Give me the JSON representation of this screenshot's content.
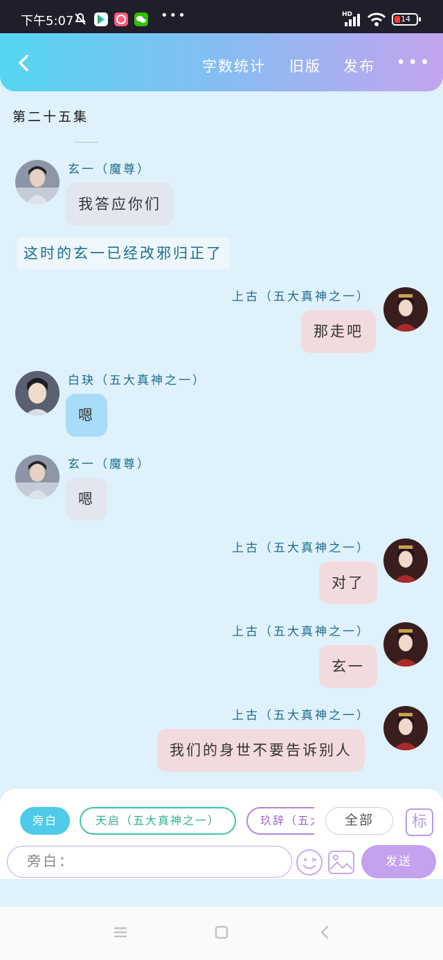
{
  "status_bar": {
    "time": "下午5:07",
    "network": "HD",
    "battery": "14",
    "more": "•••"
  },
  "header": {
    "word_count": "字数统计",
    "old_version": "旧版",
    "publish": "发布",
    "more": "•••"
  },
  "episode_title": "第二十五集",
  "messages": [
    {
      "speaker": "玄一（魔尊）",
      "text": "我答应你们"
    },
    {
      "narration": "这时的玄一已经改邪归正了"
    },
    {
      "speaker": "上古（五大真神之一）",
      "text": "那走吧"
    },
    {
      "speaker": "白玦（五大真神之一）",
      "text": "嗯"
    },
    {
      "speaker": "玄一（魔尊）",
      "text": "嗯"
    },
    {
      "speaker": "上古（五大真神之一）",
      "text": "对了"
    },
    {
      "speaker": "上古（五大真神之一）",
      "text": "玄一"
    },
    {
      "speaker": "上古（五大真神之一）",
      "text": "我们的身世不要告诉别人"
    }
  ],
  "role_chips": [
    "旁白",
    "天启（五大真神之一）",
    "玖辞（五大真神之一）",
    "全部"
  ],
  "tag_label": "标",
  "input": {
    "placeholder": "旁白："
  },
  "send_label": "发送",
  "colors": {
    "accent_cyan": "#4dcbe8",
    "accent_purple": "#c4a2ee",
    "chat_bg": "#dff1fb"
  }
}
